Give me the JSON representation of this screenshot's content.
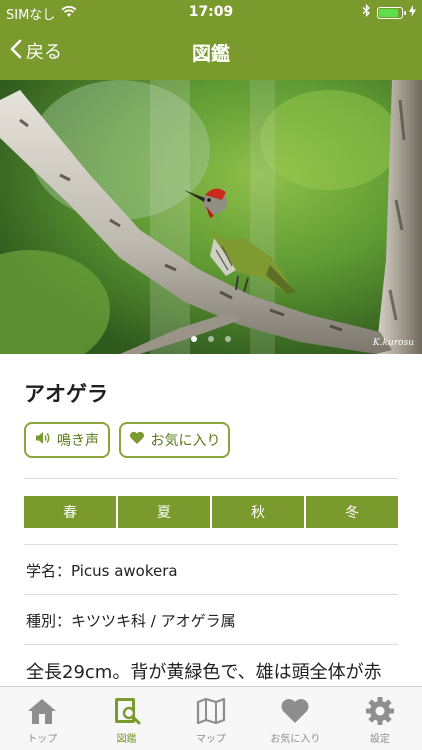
{
  "status": {
    "carrier": "SIMなし",
    "time": "17:09"
  },
  "nav": {
    "back_label": "戻る",
    "title": "図鑑"
  },
  "photo": {
    "credit": "K.kurosu",
    "page_count": 3,
    "current_page": 1
  },
  "species": {
    "name": "アオゲラ",
    "voice_button": "鳴き声",
    "favorite_button": "お気に入り",
    "seasons": [
      "春",
      "夏",
      "秋",
      "冬"
    ],
    "scientific_name": "学名：Picus awokera",
    "classification": "種別：キツツキ科 / アオゲラ属",
    "description": "全長29cm。背が黄緑色で、雄は頭全体が赤"
  },
  "tabs": [
    {
      "label": "トップ",
      "icon": "home-icon"
    },
    {
      "label": "図鑑",
      "icon": "book-search-icon"
    },
    {
      "label": "マップ",
      "icon": "map-icon"
    },
    {
      "label": "お気に入り",
      "icon": "heart-icon"
    },
    {
      "label": "設定",
      "icon": "gear-icon"
    }
  ],
  "colors": {
    "accent": "#7a9a2e",
    "tab_inactive": "#8e8e8e"
  }
}
